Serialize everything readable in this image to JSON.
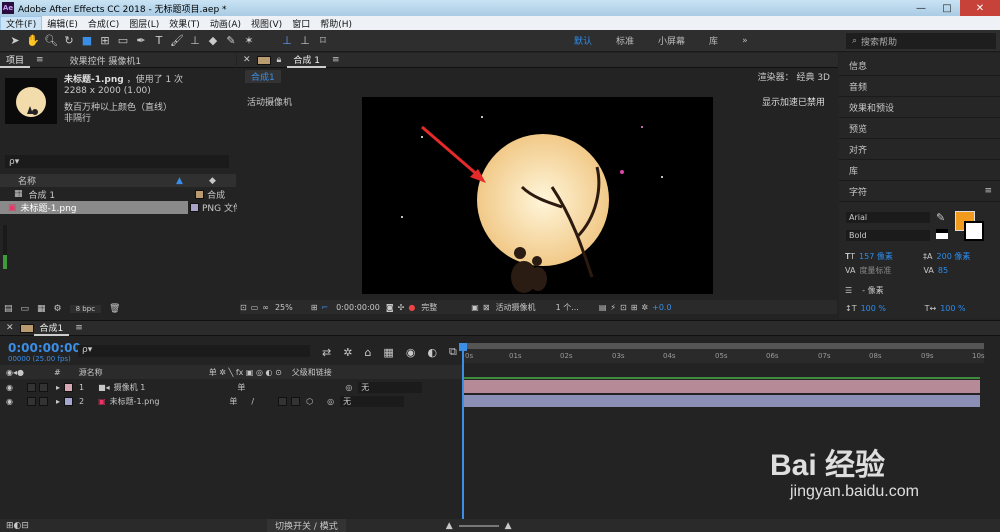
{
  "window": {
    "title": "Adobe After Effects CC 2018 - 无标题项目.aep *",
    "app_icon": "Ae",
    "minimize": "—",
    "maximize": "□",
    "close": "✕"
  },
  "menu": [
    "文件(F)",
    "编辑(E)",
    "合成(C)",
    "图层(L)",
    "效果(T)",
    "动画(A)",
    "视图(V)",
    "窗口",
    "帮助(H)"
  ],
  "toolbar": {
    "workspaces": [
      "默认",
      "标准",
      "小屏幕",
      "库"
    ],
    "workspace_menu": "»",
    "search_placeholder": "搜索帮助",
    "active_workspace": "默认"
  },
  "project": {
    "tab_project": "项目",
    "tab_effects": "效果控件 摄像机1",
    "file_name": "未标题-1.png",
    "usage": "，使用了 1 次",
    "dimensions": "2288 x 2000 (1.00)",
    "color_info": "数百万种以上颜色（直线）",
    "interlace": "非隔行",
    "col_name": "名称",
    "items": [
      {
        "name": "合成 1",
        "type": "合成",
        "color": "#b99b6f"
      },
      {
        "name": "未标题-1.png",
        "type": "PNG 文件",
        "color": "#a6a2c8"
      }
    ],
    "bpc": "8 bpc",
    "search_placeholder": "ρ▾"
  },
  "viewer": {
    "tab_label": "合成 1",
    "comp_link": "合成1",
    "renderer_label": "渲染器：",
    "renderer_value": "经典 3D",
    "camera_label": "活动摄像机",
    "gpu_notice": "显示加速已禁用",
    "zoom": "25%",
    "timecode": "0:00:00:00",
    "quality": "完整",
    "view": "活动摄像机",
    "views": "1 个...",
    "exposure": "+0.0"
  },
  "right_panels": [
    "信息",
    "音频",
    "效果和预设",
    "预览",
    "对齐",
    "库",
    "字符"
  ],
  "character": {
    "font": "Arial",
    "style": "Bold",
    "size": "157 像素",
    "leading": "200 像素",
    "kerning": "度量标准",
    "tracking": "85",
    "indent": "- 像素",
    "scale_v": "100 %",
    "scale_h": "100 %",
    "fill_color": "#f29a1e",
    "stroke_color": "#ffffff"
  },
  "timeline": {
    "comp_tab": "合成1",
    "timecode": "0:00:00:00",
    "fps": "00000 (25.00 fps)",
    "col_source": "源名称",
    "col_switches": "单 ✲ ╲ fx ▣ ◎ ◐ ⊙",
    "col_parent": "父级和链接",
    "layers": [
      {
        "num": "1",
        "name": "摄像机 1",
        "color": "#d9a6b5",
        "parent": "无",
        "bar": "#b78a98"
      },
      {
        "num": "2",
        "name": "未标题-1.png",
        "color": "#a5a7d2",
        "parent": "无",
        "bar": "#8b8fb6"
      }
    ],
    "ticks": [
      "0s",
      "01s",
      "02s",
      "03s",
      "04s",
      "05s",
      "06s",
      "07s",
      "08s",
      "09s",
      "10s"
    ],
    "bottom_toggle": "切换开关 / 模式"
  },
  "watermark": {
    "brand": "Bai 经验",
    "url": "jingyan.baidu.com"
  }
}
